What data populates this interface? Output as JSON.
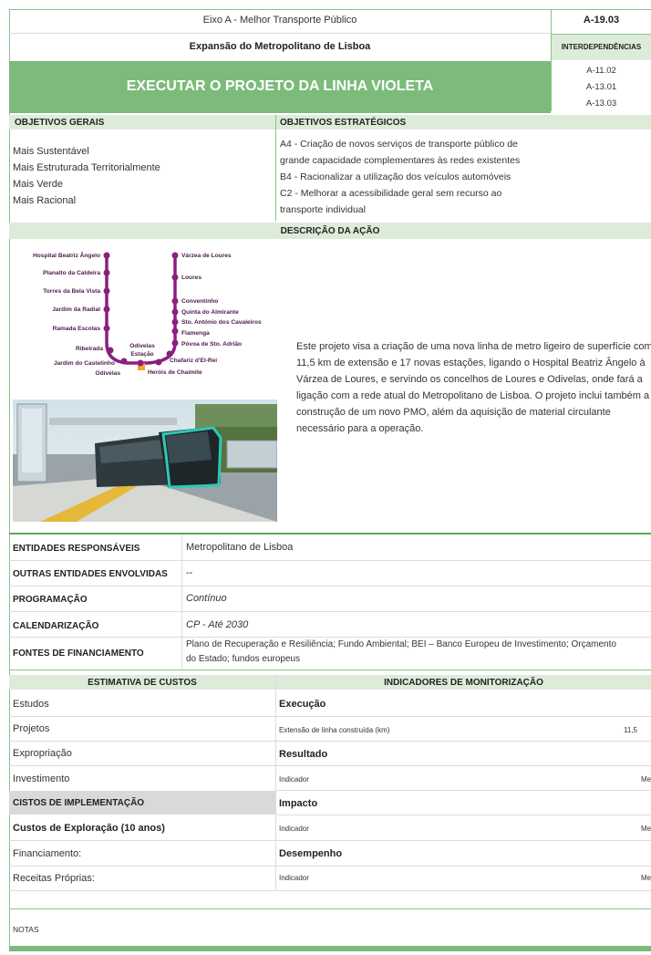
{
  "header": {
    "axis": "Eixo A - Melhor Transporte Público",
    "program": "Expansão do Metropolitano de Lisboa",
    "code": "A-19.03",
    "interdep_title": "INTERDEPENDÊNCIAS",
    "interdeps": [
      "A-11.02",
      "A-13.01",
      "A-13.03"
    ]
  },
  "banner_title": "EXECUTAR O PROJETO DA LINHA VIOLETA",
  "objetivos_gerais": {
    "title": "OBJETIVOS GERAIS",
    "items": [
      "Mais Sustentável",
      "Mais Estruturada Territorialmente",
      "Mais Verde",
      "Mais Racional"
    ]
  },
  "objetivos_estrategicos": {
    "title": "OBJETIVOS ESTRATÉGICOS",
    "lines": [
      "A4 - Criação de novos serviços de transporte público de",
      "grande capacidade complementares às redes existentes",
      "B4 - Racionalizar a utilização dos veículos automóveis",
      "C2 - Melhorar a acessibilidade geral sem recurso ao",
      "transporte individual"
    ]
  },
  "descricao": {
    "title": "DESCRIÇÃO DA AÇÃO",
    "lines": [
      "Este projeto visa a criação de uma nova linha de metro ligeiro de superfície com",
      "11,5 km de extensão e 17 novas estações, ligando o Hospital Beatriz Ângelo à",
      "Várzea de Loures, e servindo os concelhos de Loures e Odivelas, onde fará a",
      "ligação com a rede atual do Metropolitano de Lisboa. O projeto inclui também a",
      "construção de um novo PMO, além da aquisição de material circulante",
      "necessário para a operação."
    ]
  },
  "map": {
    "left_stations": [
      "Hospital Beatriz Ângelo",
      "Planalto da Caldeira",
      "Torres da Bela Vista",
      "Jardim da Radial",
      "Ramada Escolas",
      "Ribeirada",
      "Jardim do Castelinho"
    ],
    "right_stations": [
      "Várzea de Loures",
      "Loures",
      "Conventinho",
      "Quinta do Almirante",
      "Sto. António dos Cavaleiros",
      "Flamenga",
      "Póvoa de Sto. Adrião",
      "Chafariz d'El-Rei",
      "Heróis de Chaimite"
    ],
    "odivelas_estacao_1": "Odivelas",
    "odivelas_estacao_2": "Estação",
    "odivelas_bottom": "Odivelas",
    "line_color": "#8b1f7f",
    "connection_color": "#f2a72e"
  },
  "info_rows": [
    {
      "label": "ENTIDADES RESPONSÁVEIS",
      "value": "Metropolitano de Lisboa",
      "italic": false
    },
    {
      "label": "OUTRAS ENTIDADES ENVOLVIDAS",
      "value": "--",
      "italic": false
    },
    {
      "label": "PROGRAMAÇÃO",
      "value": "Contínuo",
      "italic": true
    },
    {
      "label": "CALENDARIZAÇÃO",
      "value": "CP - Até 2030",
      "italic": true
    }
  ],
  "fontes": {
    "label": "FONTES DE FINANCIAMENTO",
    "line1": "Plano de Recuperação e Resiliência; Fundo Ambiental; BEI – Banco Europeu de Investimento; Orçamento",
    "line2": "do Estado; fundos europeus"
  },
  "custos": {
    "title": "ESTIMATIVA DE CUSTOS",
    "items": [
      "Estudos",
      "Projetos",
      "Expropriação",
      "Investimento"
    ],
    "implementacao": "CISTOS DE IMPLEMENTAÇÃO",
    "exploracao": "Custos de Exploração (10 anos)",
    "financiamento": "Financiamento:",
    "receitas": "Receitas Próprias:"
  },
  "indicadores": {
    "title": "INDICADORES DE MONITORIZAÇÃO",
    "execucao": "Execução",
    "execucao_ind": "Extensão de linha construída (km)",
    "execucao_val": "11,5",
    "resultado": "Resultado",
    "resultado_ind": "Indicador",
    "resultado_val": "Me",
    "impacto": "Impacto",
    "impacto_ind": "Indicador",
    "impacto_val": "Me",
    "desempenho": "Desempenho",
    "desempenho_ind": "Indicador",
    "desempenho_val": "Me"
  },
  "notas": "NOTAS",
  "colors": {
    "green": "#7cbb7a",
    "light_green": "#dcecd9",
    "grey": "#d9d9d9"
  }
}
